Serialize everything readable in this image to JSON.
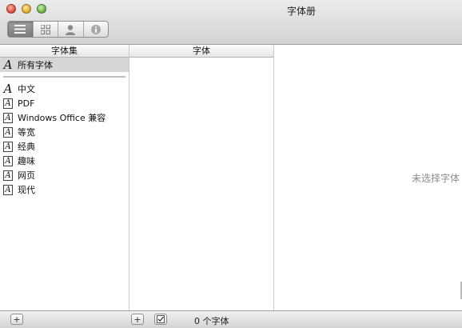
{
  "window": {
    "title": "字体册"
  },
  "toolbar": {
    "view_buttons": [
      {
        "name": "list-view-icon",
        "active": true
      },
      {
        "name": "grid-view-icon",
        "active": false
      },
      {
        "name": "user-icon",
        "active": false
      },
      {
        "name": "info-icon",
        "active": false
      }
    ]
  },
  "collections": {
    "header": "字体集",
    "all_fonts": "所有字体",
    "items": [
      "中文",
      "PDF",
      "Windows Office 兼容",
      "等宽",
      "经典",
      "趣味",
      "网页",
      "现代"
    ]
  },
  "fonts": {
    "header": "字体"
  },
  "preview": {
    "placeholder": "未选择字体"
  },
  "status": {
    "count_label": "0 个字体"
  }
}
